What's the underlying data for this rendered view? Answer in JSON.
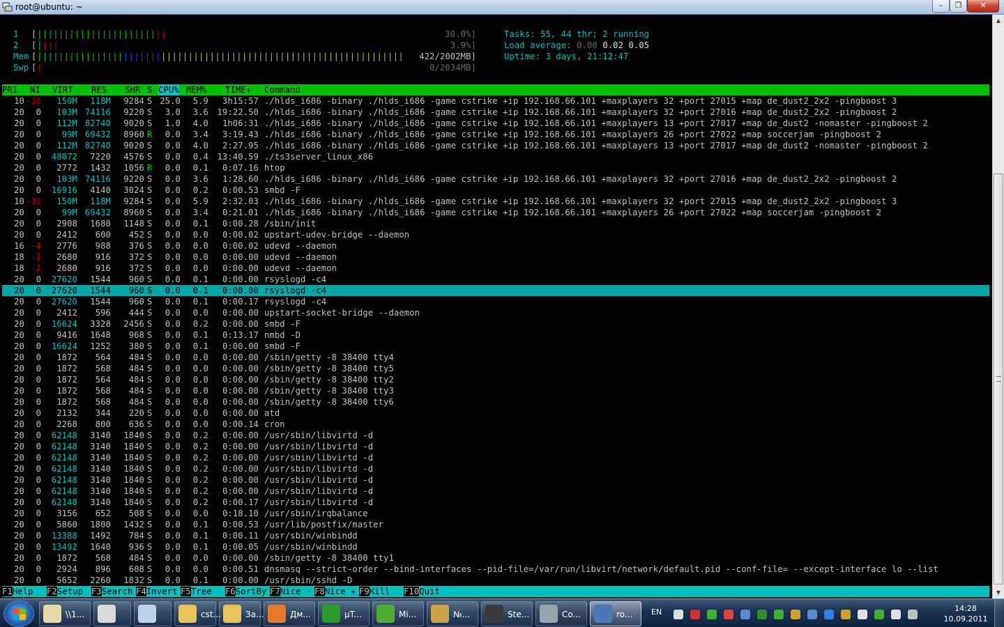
{
  "window": {
    "title": "root@ubuntu: ~",
    "minimize": "–",
    "maximize": "❐",
    "close": "✕"
  },
  "meters": {
    "cpu1": {
      "label": "1",
      "value": "30.0%]"
    },
    "cpu2": {
      "label": "2",
      "value": "3.9%]"
    },
    "mem": {
      "label": "Mem",
      "value": "422/2002MB]"
    },
    "swp": {
      "label": "Swp",
      "value": "0/2034MB]"
    }
  },
  "summary": {
    "tasks_label": "Tasks: ",
    "tasks_value": "55, 44 thr; 2 running",
    "load_label": "Load average: ",
    "load_1": "0.00",
    "load_5": "0.02",
    "load_15": "0.05",
    "uptime_label": "Uptime: ",
    "uptime_value": "3 days, 21:12:47"
  },
  "columns": [
    "PRI",
    "NI",
    "VIRT",
    "RES",
    "SHR",
    "S",
    "CPU%",
    "MEM%",
    "TIME+",
    "Command"
  ],
  "sorted_column": "CPU%",
  "processes": [
    {
      "pri": "10",
      "ni": "-10",
      "virt": "150M",
      "res": "118M",
      "shr": "9284",
      "s": "S",
      "cpu": "25.0",
      "mem": "5.9",
      "time": "3h15:57",
      "cmd": "./hlds_i686 -binary ./hlds_i686 -game cstrike +ip 192.168.66.101 +maxplayers 32 +port 27015 +map de_dust2_2x2 -pingboost 3"
    },
    {
      "pri": "20",
      "ni": "0",
      "virt": "103M",
      "res": "74116",
      "shr": "9220",
      "s": "S",
      "cpu": "3.0",
      "mem": "3.6",
      "time": "19:22.50",
      "cmd": "./hlds_i686 -binary ./hlds_i686 -game cstrike +ip 192.168.66.101 +maxplayers 32 +port 27016 +map de_dust2_2x2 -pingboost 2"
    },
    {
      "pri": "20",
      "ni": "0",
      "virt": "112M",
      "res": "82740",
      "shr": "9020",
      "s": "S",
      "cpu": "1.0",
      "mem": "4.0",
      "time": "1h06:31",
      "cmd": "./hlds_i686 -binary ./hlds_i686 -game cstrike +ip 192.168.66.101 +maxplayers 13 +port 27017 +map de_dust2 -nomaster -pingboost 2"
    },
    {
      "pri": "20",
      "ni": "0",
      "virt": "99M",
      "res": "69432",
      "shr": "8960",
      "s": "R",
      "cpu": "0.0",
      "mem": "3.4",
      "time": "3:19.43",
      "cmd": "./hlds_i686 -binary ./hlds_i686 -game cstrike +ip 192.168.66.101 +maxplayers 26 +port 27022 +map soccerjam -pingboost 2"
    },
    {
      "pri": "20",
      "ni": "0",
      "virt": "112M",
      "res": "82740",
      "shr": "9020",
      "s": "S",
      "cpu": "0.0",
      "mem": "4.0",
      "time": "2:27.95",
      "cmd": "./hlds_i686 -binary ./hlds_i686 -game cstrike +ip 192.168.66.101 +maxplayers 13 +port 27017 +map de_dust2 -nomaster -pingboost 2"
    },
    {
      "pri": "20",
      "ni": "0",
      "virt": "48072",
      "res": "7220",
      "shr": "4576",
      "s": "S",
      "cpu": "0.0",
      "mem": "0.4",
      "time": "13:40.59",
      "cmd": "./ts3server_linux_x86"
    },
    {
      "pri": "20",
      "ni": "0",
      "virt": "2772",
      "res": "1432",
      "shr": "1056",
      "s": "R",
      "cpu": "0.0",
      "mem": "0.1",
      "time": "0:07.16",
      "cmd": "htop"
    },
    {
      "pri": "20",
      "ni": "0",
      "virt": "103M",
      "res": "74116",
      "shr": "9220",
      "s": "S",
      "cpu": "0.0",
      "mem": "3.6",
      "time": "1:28.60",
      "cmd": "./hlds_i686 -binary ./hlds_i686 -game cstrike +ip 192.168.66.101 +maxplayers 32 +port 27016 +map de_dust2_2x2 -pingboost 2"
    },
    {
      "pri": "20",
      "ni": "0",
      "virt": "16916",
      "res": "4140",
      "shr": "3024",
      "s": "S",
      "cpu": "0.0",
      "mem": "0.2",
      "time": "0:00.53",
      "cmd": "smbd -F"
    },
    {
      "pri": "10",
      "ni": "-10",
      "virt": "150M",
      "res": "118M",
      "shr": "9284",
      "s": "S",
      "cpu": "0.0",
      "mem": "5.9",
      "time": "2:32.03",
      "cmd": "./hlds_i686 -binary ./hlds_i686 -game cstrike +ip 192.168.66.101 +maxplayers 32 +port 27015 +map de_dust2_2x2 -pingboost 3"
    },
    {
      "pri": "20",
      "ni": "0",
      "virt": "99M",
      "res": "69432",
      "shr": "8960",
      "s": "S",
      "cpu": "0.0",
      "mem": "3.4",
      "time": "0:21.01",
      "cmd": "./hlds_i686 -binary ./hlds_i686 -game cstrike +ip 192.168.66.101 +maxplayers 26 +port 27022 +map soccerjam -pingboost 2"
    },
    {
      "pri": "20",
      "ni": "0",
      "virt": "2908",
      "res": "1680",
      "shr": "1148",
      "s": "S",
      "cpu": "0.0",
      "mem": "0.1",
      "time": "0:00.28",
      "cmd": "/sbin/init"
    },
    {
      "pri": "20",
      "ni": "0",
      "virt": "2412",
      "res": "600",
      "shr": "452",
      "s": "S",
      "cpu": "0.0",
      "mem": "0.0",
      "time": "0:00.02",
      "cmd": "upstart-udev-bridge --daemon"
    },
    {
      "pri": "16",
      "ni": "-4",
      "virt": "2776",
      "res": "988",
      "shr": "376",
      "s": "S",
      "cpu": "0.0",
      "mem": "0.0",
      "time": "0:00.02",
      "cmd": "udevd --daemon"
    },
    {
      "pri": "18",
      "ni": "-2",
      "virt": "2680",
      "res": "916",
      "shr": "372",
      "s": "S",
      "cpu": "0.0",
      "mem": "0.0",
      "time": "0:00.00",
      "cmd": "udevd --daemon"
    },
    {
      "pri": "18",
      "ni": "-2",
      "virt": "2680",
      "res": "916",
      "shr": "372",
      "s": "S",
      "cpu": "0.0",
      "mem": "0.0",
      "time": "0:00.00",
      "cmd": "udevd --daemon"
    },
    {
      "pri": "20",
      "ni": "0",
      "virt": "27620",
      "res": "1544",
      "shr": "960",
      "s": "S",
      "cpu": "0.0",
      "mem": "0.1",
      "time": "0:00.00",
      "cmd": "rsyslogd -c4"
    },
    {
      "pri": "20",
      "ni": "0",
      "virt": "27620",
      "res": "1544",
      "shr": "960",
      "s": "S",
      "cpu": "0.0",
      "mem": "0.1",
      "time": "0:00.00",
      "cmd": "rsyslogd -c4",
      "selected": true
    },
    {
      "pri": "20",
      "ni": "0",
      "virt": "27620",
      "res": "1544",
      "shr": "960",
      "s": "S",
      "cpu": "0.0",
      "mem": "0.1",
      "time": "0:00.17",
      "cmd": "rsyslogd -c4"
    },
    {
      "pri": "20",
      "ni": "0",
      "virt": "2412",
      "res": "596",
      "shr": "444",
      "s": "S",
      "cpu": "0.0",
      "mem": "0.0",
      "time": "0:00.00",
      "cmd": "upstart-socket-bridge --daemon"
    },
    {
      "pri": "20",
      "ni": "0",
      "virt": "16624",
      "res": "3328",
      "shr": "2456",
      "s": "S",
      "cpu": "0.0",
      "mem": "0.2",
      "time": "0:00.00",
      "cmd": "smbd -F"
    },
    {
      "pri": "20",
      "ni": "0",
      "virt": "9416",
      "res": "1648",
      "shr": "968",
      "s": "S",
      "cpu": "0.0",
      "mem": "0.1",
      "time": "0:13.17",
      "cmd": "nmbd -D"
    },
    {
      "pri": "20",
      "ni": "0",
      "virt": "16624",
      "res": "1252",
      "shr": "380",
      "s": "S",
      "cpu": "0.0",
      "mem": "0.1",
      "time": "0:00.00",
      "cmd": "smbd -F"
    },
    {
      "pri": "20",
      "ni": "0",
      "virt": "1872",
      "res": "564",
      "shr": "484",
      "s": "S",
      "cpu": "0.0",
      "mem": "0.0",
      "time": "0:00.00",
      "cmd": "/sbin/getty -8 38400 tty4"
    },
    {
      "pri": "20",
      "ni": "0",
      "virt": "1872",
      "res": "568",
      "shr": "484",
      "s": "S",
      "cpu": "0.0",
      "mem": "0.0",
      "time": "0:00.00",
      "cmd": "/sbin/getty -8 38400 tty5"
    },
    {
      "pri": "20",
      "ni": "0",
      "virt": "1872",
      "res": "564",
      "shr": "484",
      "s": "S",
      "cpu": "0.0",
      "mem": "0.0",
      "time": "0:00.00",
      "cmd": "/sbin/getty -8 38400 tty2"
    },
    {
      "pri": "20",
      "ni": "0",
      "virt": "1872",
      "res": "568",
      "shr": "484",
      "s": "S",
      "cpu": "0.0",
      "mem": "0.0",
      "time": "0:00.00",
      "cmd": "/sbin/getty -8 38400 tty3"
    },
    {
      "pri": "20",
      "ni": "0",
      "virt": "1872",
      "res": "568",
      "shr": "484",
      "s": "S",
      "cpu": "0.0",
      "mem": "0.0",
      "time": "0:00.00",
      "cmd": "/sbin/getty -8 38400 tty6"
    },
    {
      "pri": "20",
      "ni": "0",
      "virt": "2132",
      "res": "344",
      "shr": "220",
      "s": "S",
      "cpu": "0.0",
      "mem": "0.0",
      "time": "0:00.00",
      "cmd": "atd"
    },
    {
      "pri": "20",
      "ni": "0",
      "virt": "2268",
      "res": "800",
      "shr": "636",
      "s": "S",
      "cpu": "0.0",
      "mem": "0.0",
      "time": "0:00.14",
      "cmd": "cron"
    },
    {
      "pri": "20",
      "ni": "0",
      "virt": "62148",
      "res": "3140",
      "shr": "1840",
      "s": "S",
      "cpu": "0.0",
      "mem": "0.2",
      "time": "0:00.00",
      "cmd": "/usr/sbin/libvirtd -d"
    },
    {
      "pri": "20",
      "ni": "0",
      "virt": "62148",
      "res": "3140",
      "shr": "1840",
      "s": "S",
      "cpu": "0.0",
      "mem": "0.2",
      "time": "0:00.00",
      "cmd": "/usr/sbin/libvirtd -d"
    },
    {
      "pri": "20",
      "ni": "0",
      "virt": "62148",
      "res": "3140",
      "shr": "1840",
      "s": "S",
      "cpu": "0.0",
      "mem": "0.2",
      "time": "0:00.00",
      "cmd": "/usr/sbin/libvirtd -d"
    },
    {
      "pri": "20",
      "ni": "0",
      "virt": "62148",
      "res": "3140",
      "shr": "1840",
      "s": "S",
      "cpu": "0.0",
      "mem": "0.2",
      "time": "0:00.00",
      "cmd": "/usr/sbin/libvirtd -d"
    },
    {
      "pri": "20",
      "ni": "0",
      "virt": "62148",
      "res": "3140",
      "shr": "1840",
      "s": "S",
      "cpu": "0.0",
      "mem": "0.2",
      "time": "0:00.00",
      "cmd": "/usr/sbin/libvirtd -d"
    },
    {
      "pri": "20",
      "ni": "0",
      "virt": "62148",
      "res": "3140",
      "shr": "1840",
      "s": "S",
      "cpu": "0.0",
      "mem": "0.2",
      "time": "0:00.00",
      "cmd": "/usr/sbin/libvirtd -d"
    },
    {
      "pri": "20",
      "ni": "0",
      "virt": "62148",
      "res": "3140",
      "shr": "1840",
      "s": "S",
      "cpu": "0.0",
      "mem": "0.2",
      "time": "0:00.17",
      "cmd": "/usr/sbin/libvirtd -d"
    },
    {
      "pri": "20",
      "ni": "0",
      "virt": "3156",
      "res": "652",
      "shr": "508",
      "s": "S",
      "cpu": "0.0",
      "mem": "0.0",
      "time": "0:18.10",
      "cmd": "/usr/sbin/irqbalance"
    },
    {
      "pri": "20",
      "ni": "0",
      "virt": "5860",
      "res": "1800",
      "shr": "1432",
      "s": "S",
      "cpu": "0.0",
      "mem": "0.1",
      "time": "0:00.53",
      "cmd": "/usr/lib/postfix/master"
    },
    {
      "pri": "20",
      "ni": "0",
      "virt": "13388",
      "res": "1492",
      "shr": "784",
      "s": "S",
      "cpu": "0.0",
      "mem": "0.1",
      "time": "0:00.11",
      "cmd": "/usr/sbin/winbindd"
    },
    {
      "pri": "20",
      "ni": "0",
      "virt": "13492",
      "res": "1640",
      "shr": "936",
      "s": "S",
      "cpu": "0.0",
      "mem": "0.1",
      "time": "0:00.05",
      "cmd": "/usr/sbin/winbindd"
    },
    {
      "pri": "20",
      "ni": "0",
      "virt": "1872",
      "res": "568",
      "shr": "484",
      "s": "S",
      "cpu": "0.0",
      "mem": "0.0",
      "time": "0:00.00",
      "cmd": "/sbin/getty -8 38400 tty1"
    },
    {
      "pri": "20",
      "ni": "0",
      "virt": "2924",
      "res": "896",
      "shr": "608",
      "s": "S",
      "cpu": "0.0",
      "mem": "0.0",
      "time": "0:00.51",
      "cmd": "dnsmasq --strict-order --bind-interfaces --pid-file=/var/run/libvirt/network/default.pid --conf-file= --except-interface lo --list"
    },
    {
      "pri": "20",
      "ni": "0",
      "virt": "5652",
      "res": "2260",
      "shr": "1832",
      "s": "S",
      "cpu": "0.0",
      "mem": "0.1",
      "time": "0:00.00",
      "cmd": "/usr/sbin/sshd -D"
    }
  ],
  "fkeys": [
    {
      "key": "F1",
      "label": "Help  "
    },
    {
      "key": "F2",
      "label": "Setup "
    },
    {
      "key": "F3",
      "label": "Search"
    },
    {
      "key": "F4",
      "label": "Invert"
    },
    {
      "key": "F5",
      "label": "Tree  "
    },
    {
      "key": "F6",
      "label": "SortBy"
    },
    {
      "key": "F7",
      "label": "Nice -"
    },
    {
      "key": "F8",
      "label": "Nice +"
    },
    {
      "key": "F9",
      "label": "Kill  "
    },
    {
      "key": "F10",
      "label": "Quit"
    }
  ],
  "taskbar": {
    "tasks": [
      {
        "label": "\\\\1...",
        "icon": "notepad-icon"
      },
      {
        "label": "",
        "icon": "media-player-classic-icon"
      },
      {
        "label": "",
        "icon": "blank-pad-icon"
      },
      {
        "label": "cst...",
        "icon": "folder-icon"
      },
      {
        "label": "За...",
        "icon": "folder-icon"
      },
      {
        "label": "Дм...",
        "icon": "firefox-icon"
      },
      {
        "label": "µT...",
        "icon": "utorrent-icon"
      },
      {
        "label": "Mi...",
        "icon": "miranda-icon"
      },
      {
        "label": "№...",
        "icon": "qip-icon"
      },
      {
        "label": "Ste...",
        "icon": "steam-icon"
      },
      {
        "label": "Co...",
        "icon": "counter-strike-icon"
      },
      {
        "label": "ro...",
        "icon": "putty-icon",
        "active": true
      }
    ],
    "language": "EN",
    "time": "14:28",
    "date": "10.09.2011"
  }
}
